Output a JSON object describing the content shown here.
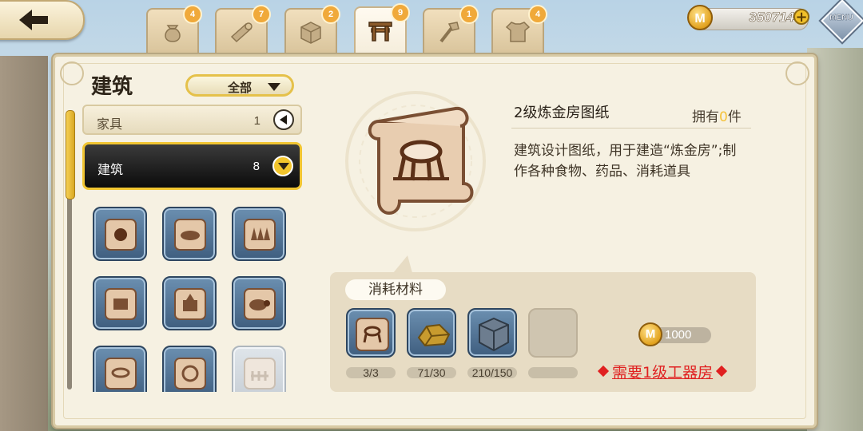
{
  "top_bar": {
    "tabs": [
      {
        "icon": "pouch-icon",
        "badge": "4"
      },
      {
        "icon": "log-icon",
        "badge": "7"
      },
      {
        "icon": "block-icon",
        "badge": "2"
      },
      {
        "icon": "bench-icon",
        "badge": "9",
        "active": true
      },
      {
        "icon": "hammer-icon",
        "badge": "1"
      },
      {
        "icon": "armor-icon",
        "badge": "4"
      }
    ],
    "coins": "350714",
    "coin_symbol": "M",
    "menu_label": "MENU"
  },
  "left_panel": {
    "title": "建筑",
    "filter_label": "全部",
    "categories": [
      {
        "name": "家具",
        "count": "1"
      },
      {
        "name": "建筑",
        "count": "8"
      }
    ]
  },
  "detail": {
    "item_name": "2级炼金房图纸",
    "owned_prefix": "拥有",
    "owned_count": "0",
    "owned_suffix": "件",
    "description": "建筑设计图纸，用于建造“炼金房”;制作各种食物、药品、消耗道具",
    "materials_title": "消耗材料",
    "materials": [
      {
        "icon": "blueprint-icon",
        "count": "3/3"
      },
      {
        "icon": "gold-ore-icon",
        "count": "71/30"
      },
      {
        "icon": "stone-block-icon",
        "count": "210/150"
      },
      {
        "icon": "empty-slot",
        "count": ""
      }
    ],
    "cost_symbol": "M",
    "cost": "1000",
    "requirement": "需要1级工器房"
  },
  "colors": {
    "accent_gold": "#f1c531",
    "requirement_red": "#e02020",
    "owned_highlight": "#f5c23a"
  }
}
